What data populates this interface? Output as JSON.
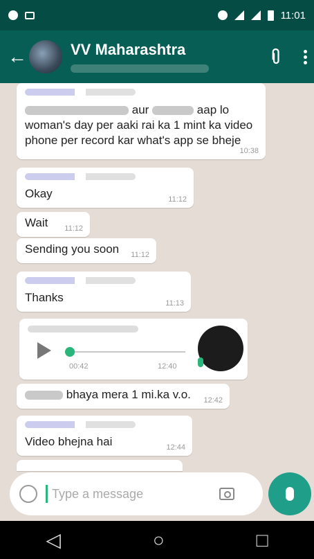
{
  "status_bar": {
    "time": "11:01"
  },
  "header": {
    "back_icon": "arrow-left-icon",
    "title": "VV Maharashtra"
  },
  "messages": [
    {
      "text_line1_tail": "aur",
      "text_line1_tail2": "aap lo",
      "text_line2": "woman's day per aaki rai ka 1 mint ka video",
      "text_line3": "phone per  record kar what's app se bheje",
      "time": "10:38"
    },
    {
      "text": "Okay",
      "time": "11:12"
    },
    {
      "text": "Wait",
      "time": "11:12"
    },
    {
      "text": "Sending you soon",
      "time": "11:12"
    },
    {
      "text": "Thanks",
      "time": "11:13"
    },
    {
      "voice_duration": "00:42",
      "time": "12:40"
    },
    {
      "text": "bhaya mera 1 mi.ka v.o.",
      "time": "12:42"
    },
    {
      "text": "Video bhejna hai",
      "time": "12:44"
    }
  ],
  "composer": {
    "placeholder": "Type a message"
  },
  "colors": {
    "app_bar": "#075e54",
    "status_bar": "#054d44",
    "accent": "#1f9e8a",
    "chat_bg": "#e5ddd5"
  }
}
